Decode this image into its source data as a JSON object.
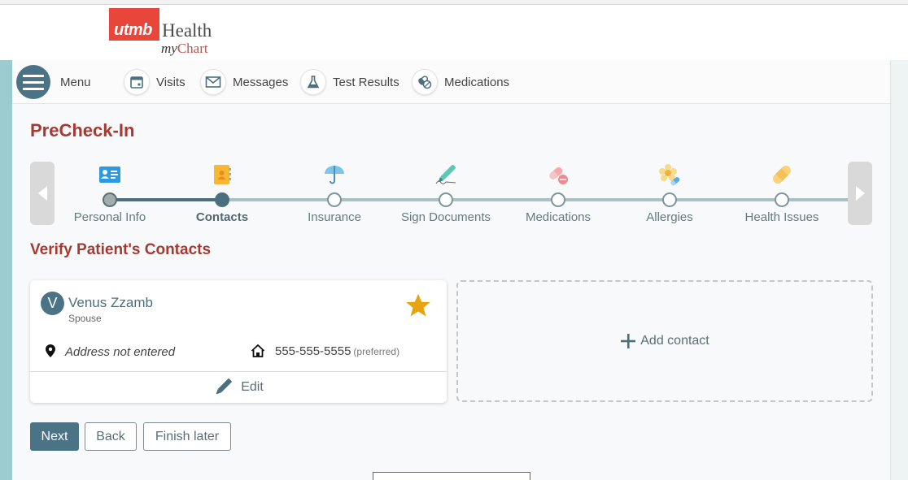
{
  "header": {
    "logo": {
      "brand": "utmb",
      "health": "Health",
      "my": "my",
      "chart": "Chart"
    }
  },
  "nav": {
    "items": [
      {
        "label": "Menu",
        "icon": "hamburger-menu-icon"
      },
      {
        "label": "Visits",
        "icon": "calendar-icon"
      },
      {
        "label": "Messages",
        "icon": "envelope-icon"
      },
      {
        "label": "Test Results",
        "icon": "flask-icon"
      },
      {
        "label": "Medications",
        "icon": "pills-icon"
      }
    ]
  },
  "page": {
    "title": "PreCheck-In",
    "section_title": "Verify Patient's Contacts"
  },
  "stepper": {
    "prev_icon": "chevron-left-icon",
    "next_icon": "chevron-right-icon",
    "steps": [
      {
        "label": "Personal Info",
        "status": "done",
        "icon": "id-card-icon"
      },
      {
        "label": "Contacts",
        "status": "current",
        "icon": "address-book-icon"
      },
      {
        "label": "Insurance",
        "status": "todo",
        "icon": "umbrella-icon"
      },
      {
        "label": "Sign Documents",
        "status": "todo",
        "icon": "pen-signature-icon"
      },
      {
        "label": "Medications",
        "status": "todo",
        "icon": "pill-icon"
      },
      {
        "label": "Allergies",
        "status": "todo",
        "icon": "flower-allergy-icon"
      },
      {
        "label": "Health Issues",
        "status": "todo",
        "icon": "bandage-icon"
      }
    ]
  },
  "contact": {
    "initial": "V",
    "name": "Venus Zzamb",
    "relationship": "Spouse",
    "address": "Address not entered",
    "phone": "555-555-5555",
    "phone_note": "(preferred)",
    "edit_label": "Edit",
    "star_color": "#e8a30f"
  },
  "add_contact": {
    "label": "Add contact"
  },
  "buttons": {
    "next": "Next",
    "back": "Back",
    "finish_later": "Finish later"
  },
  "colors": {
    "accent": "#4a7486",
    "title_red": "#a63a32",
    "brand_red": "#e8463a"
  }
}
